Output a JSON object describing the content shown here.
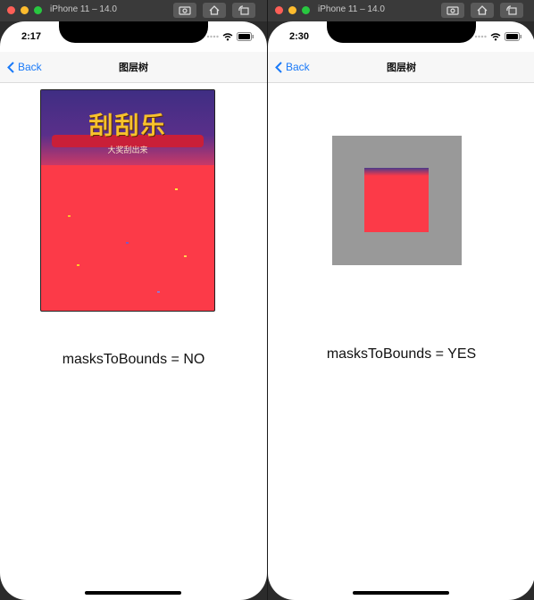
{
  "left": {
    "window_title": "iPhone 11 – 14.0",
    "time": "2:17",
    "nav": {
      "back_label": "Back",
      "title": "图层树"
    },
    "card": {
      "title": "刮刮乐",
      "subtitle": "大奖刮出来"
    },
    "caption": "masksToBounds = NO"
  },
  "right": {
    "window_title": "iPhone 11 – 14.0",
    "time": "2:30",
    "nav": {
      "back_label": "Back",
      "title": "图层树"
    },
    "caption": "masksToBounds = YES"
  },
  "colors": {
    "accent": "#1a7af8",
    "layer_red": "#fc3a48",
    "mask_gray": "#999999"
  }
}
